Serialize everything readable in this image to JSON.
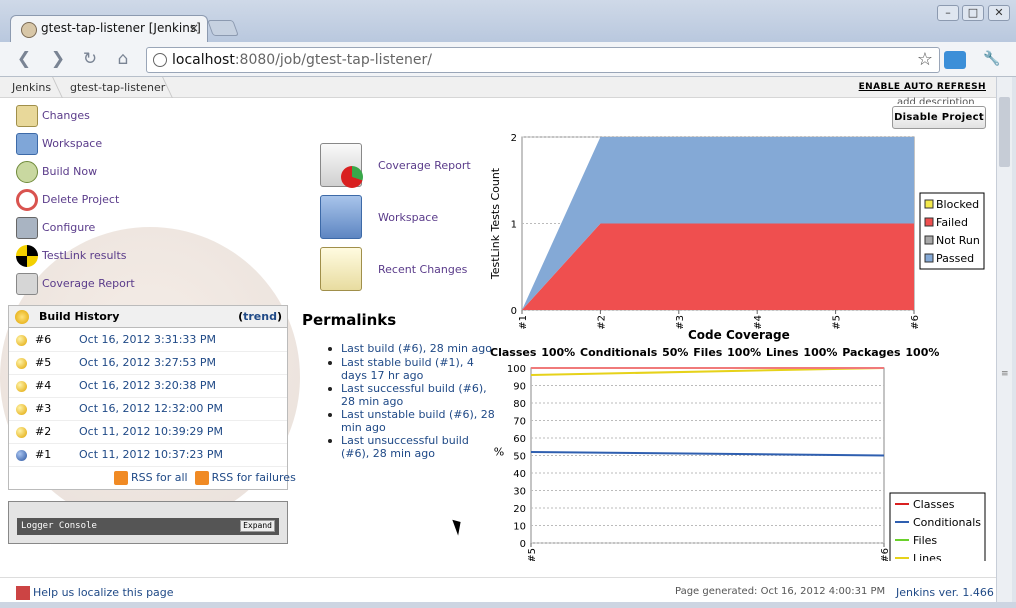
{
  "browser": {
    "tab_title": "gtest-tap-listener [Jenkins]",
    "tab_close": "×",
    "url_host": "localhost",
    "url_rest": ":8080/job/gtest-tap-listener/",
    "win_min": "–",
    "win_max": "□",
    "win_close": "✕",
    "back": "❮",
    "forward": "❯",
    "reload": "↻",
    "home": "⌂",
    "star": "☆",
    "wrench": "🔧"
  },
  "breadcrumb": {
    "root": "Jenkins",
    "job": "gtest-tap-listener",
    "auto_refresh": "ENABLE AUTO REFRESH"
  },
  "tasks": [
    {
      "label": "Changes",
      "icon": "notepad-icon",
      "color": "#e8d89a"
    },
    {
      "label": "Workspace",
      "icon": "folder-icon",
      "color": "#7fa6d8"
    },
    {
      "label": "Build Now",
      "icon": "clock-icon",
      "color": "#c9d8a0"
    },
    {
      "label": "Delete Project",
      "icon": "no-entry-icon",
      "color": "#d9534f"
    },
    {
      "label": "Configure",
      "icon": "tools-icon",
      "color": "#a9b4c2"
    },
    {
      "label": "TestLink results",
      "icon": "testlink-icon",
      "color": "#f3d000"
    },
    {
      "label": "Coverage Report",
      "icon": "coverage-icon",
      "color": "#d6d6d6"
    }
  ],
  "build_history": {
    "title": "Build History",
    "trend_open": "(",
    "trend": "trend",
    "trend_close": ")",
    "rows": [
      {
        "num": "#6",
        "date": "Oct 16, 2012 3:31:33 PM",
        "status": "#f0c020"
      },
      {
        "num": "#5",
        "date": "Oct 16, 2012 3:27:53 PM",
        "status": "#f0c020"
      },
      {
        "num": "#4",
        "date": "Oct 16, 2012 3:20:38 PM",
        "status": "#f0c020"
      },
      {
        "num": "#3",
        "date": "Oct 16, 2012 12:32:00 PM",
        "status": "#f0c020"
      },
      {
        "num": "#2",
        "date": "Oct 11, 2012 10:39:29 PM",
        "status": "#f0c020"
      },
      {
        "num": "#1",
        "date": "Oct 11, 2012 10:37:23 PM",
        "status": "#3a66b0"
      }
    ],
    "rss_all": "RSS for all",
    "rss_failures": "RSS for failures"
  },
  "logger": {
    "title": "Logger Console",
    "expand": "Expand"
  },
  "main_links": [
    {
      "label": "Coverage Report",
      "icon": "coverage-report-icon"
    },
    {
      "label": "Workspace",
      "icon": "workspace-folder-icon"
    },
    {
      "label": "Recent Changes",
      "icon": "recent-changes-icon"
    }
  ],
  "permalinks": {
    "title": "Permalinks",
    "items": [
      "Last build (#6), 28 min ago",
      "Last stable build (#1), 4 days 17 hr ago",
      "Last successful build (#6), 28 min ago",
      "Last unstable build (#6), 28 min ago",
      "Last unsuccessful build (#6), 28 min ago"
    ]
  },
  "actions": {
    "disable_project": "Disable Project",
    "add_description": "add description"
  },
  "coverage": {
    "title": "Code Coverage",
    "header": "Classes   100% Conditionals   50% Files   100% Lines   100% Packages   100%"
  },
  "chart_data": [
    {
      "type": "area",
      "title": "",
      "ylabel": "TestLink Tests Count",
      "xlabel": "",
      "ylim": [
        0,
        2
      ],
      "categories": [
        "#1",
        "#2",
        "#3",
        "#4",
        "#5",
        "#6"
      ],
      "yticks": [
        0,
        1,
        2
      ],
      "stacked": true,
      "legend": "right",
      "series": [
        {
          "name": "Blocked",
          "color": "#f3e94b",
          "values": [
            0,
            0,
            0,
            0,
            0,
            0
          ]
        },
        {
          "name": "Failed",
          "color": "#ef4f4f",
          "values": [
            0,
            1,
            1,
            1,
            1,
            1
          ]
        },
        {
          "name": "Not Run",
          "color": "#a8a8a8",
          "values": [
            0,
            0,
            0,
            0,
            0,
            0
          ]
        },
        {
          "name": "Passed",
          "color": "#84a9d6",
          "values": [
            0,
            1,
            1,
            1,
            1,
            1
          ]
        }
      ]
    },
    {
      "type": "line",
      "title": "",
      "ylabel": "%",
      "xlabel": "",
      "ylim": [
        0,
        100
      ],
      "categories": [
        "#5",
        "#6"
      ],
      "yticks": [
        0,
        10,
        20,
        30,
        40,
        50,
        60,
        70,
        80,
        90,
        100
      ],
      "legend": "right",
      "grid": true,
      "series": [
        {
          "name": "Classes",
          "color": "#d92020",
          "values": [
            100,
            100
          ]
        },
        {
          "name": "Conditionals",
          "color": "#2f5fb0",
          "values": [
            52,
            50
          ]
        },
        {
          "name": "Files",
          "color": "#6ad12b",
          "values": [
            100,
            100
          ]
        },
        {
          "name": "Lines",
          "color": "#e6d21a",
          "values": [
            96,
            100
          ]
        },
        {
          "name": "Packages",
          "color": "#f07a7a",
          "values": [
            100,
            100
          ]
        }
      ]
    }
  ],
  "footer": {
    "localize": "Help us localize this page",
    "generated": "Page generated: Oct 16, 2012 4:00:31 PM",
    "version": "Jenkins ver. 1.466"
  }
}
